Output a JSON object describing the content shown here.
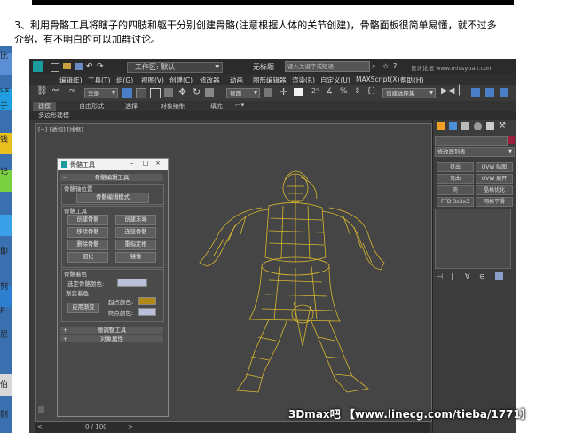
{
  "page": {
    "caption_line1": "3、利用骨骼工具将瞎子的四肢和躯干分别创建骨骼(注意根据人体的关节创建)，骨骼面板很简单易懂，就不过多",
    "caption_line2": "介绍，有不明白的可以加群讨论。",
    "watermark": "3Dmax吧 【www.linecg.com/tieba/1771】"
  },
  "desktop": {
    "labels": [
      "比",
      "us",
      "于",
      "钱",
      "记",
      "即",
      "刻",
      "P",
      "尼",
      "伯",
      "制"
    ]
  },
  "app": {
    "title": "无标题",
    "workspace": "工作区: 默认",
    "search_placeholder": "键入关键字或短语",
    "site_text": "设计论坛 www.missyuan.com",
    "menus": [
      "编辑(E)",
      "工具(T)",
      "组(G)",
      "视图(V)",
      "创建(C)",
      "修改器",
      "动画",
      "图形编辑器",
      "渲染(R)",
      "自定义(U)",
      "MAXScript(X)",
      "帮助(H)"
    ],
    "selection_filter": "全部",
    "view_dropdown": "视图",
    "selection_set": "创建选择集",
    "ribbon_tabs": [
      "建模",
      "自由形式",
      "选择",
      "对象绘制",
      "填充"
    ],
    "ribbon_sub": "多边形建模",
    "viewport_label": "[+] [透视] [线框]",
    "timeline": "0 / 100",
    "modifier_list": "修改器列表",
    "cmd_buttons": [
      [
        "挤出",
        "UVW 贴图"
      ],
      [
        "弯曲",
        "UVW 展开"
      ],
      [
        "壳",
        "晶格优化"
      ],
      [
        "FFD 3x3x3",
        "网格平滑"
      ]
    ]
  },
  "bone_dialog": {
    "title": "骨骼工具",
    "rollout_bone_edit": "骨骼编辑工具",
    "group_bone_pivot": "骨骼轴位置",
    "btn_bone_edit_mode": "骨骼编辑模式",
    "group_bone_tools": "骨骼工具",
    "btn_create_bones": "创建骨骼",
    "btn_create_end": "创建末端",
    "btn_remove_bone": "移除骨骼",
    "btn_connect_bones": "连接骨骼",
    "btn_delete_bone": "删除骨骼",
    "btn_reassign_root": "重指定根",
    "btn_refine": "细化",
    "btn_mirror": "镜像",
    "group_bone_coloring": "骨骼着色",
    "selected_bone_color_label": "选定骨骼颜色:",
    "gradient_coloring_label": "渐变着色",
    "btn_apply_gradient": "应用渐变",
    "start_color_label": "起点颜色:",
    "end_color_label": "终点颜色:",
    "rollout_fin_adjust": "鳍调整工具",
    "rollout_object_props": "对象属性",
    "colors": {
      "selected": "#b7c0d8",
      "start": "#b08a18",
      "end": "#b7c0d8"
    }
  },
  "colors": {
    "wireframe": "#d8b830",
    "accent_blue": "#3a6fb0"
  }
}
